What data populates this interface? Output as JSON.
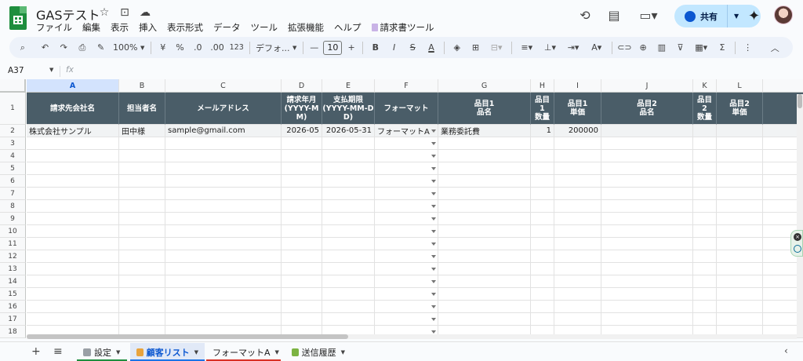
{
  "app": {
    "title": "GASテスト",
    "title_icons": [
      "star-icon",
      "move-to-folder-icon",
      "cloud-saved-icon"
    ]
  },
  "menu": [
    "ファイル",
    "編集",
    "表示",
    "挿入",
    "表示形式",
    "データ",
    "ツール",
    "拡張機能",
    "ヘルプ"
  ],
  "menu_ext": "請求書ツール",
  "share": {
    "label": "共有"
  },
  "toolbar": {
    "zoom": "100%",
    "currency": "¥",
    "percent": "%",
    "dec_decrease": ".0",
    "dec_increase": ".00",
    "number_format": "123",
    "font": "デフォ...",
    "font_size": "10",
    "minus": "—",
    "plus": "+",
    "bold": "B",
    "italic": "I",
    "strike": "S",
    "text_color": "A",
    "sum": "Σ",
    "more": "⋮",
    "collapse": "︿"
  },
  "formula_bar": {
    "name_box": "A37",
    "fx": "fx"
  },
  "columns": [
    "A",
    "B",
    "C",
    "D",
    "E",
    "F",
    "G",
    "H",
    "I",
    "J",
    "K",
    "L"
  ],
  "selected_column": "A",
  "header_row": {
    "row_number": "1",
    "cells": [
      "請求先会社名",
      "担当者名",
      "メールアドレス",
      "請求年月\n(YYYY-M\nM)",
      "支払期限\n(YYYY-MM-D\nD)",
      "フォーマット",
      "品目1\n品名",
      "品目\n1\n数量",
      "品目1\n単価",
      "品目2\n品名",
      "品目\n2\n数量",
      "品目2\n単価"
    ]
  },
  "data_rows": [
    {
      "row_number": "2",
      "cells": [
        "株式会社サンプル",
        "田中様",
        "sample@gmail.com",
        "2026-05",
        "2026-05-31",
        "フォーマットA",
        "業務委託費",
        "1",
        "200000",
        "",
        "",
        ""
      ]
    }
  ],
  "empty_row_numbers": [
    "3",
    "4",
    "5",
    "6",
    "7",
    "8",
    "9",
    "10",
    "11",
    "12",
    "13",
    "14",
    "15",
    "16",
    "17",
    "18"
  ],
  "sheet_tabs": [
    {
      "label": "設定",
      "icon": "gear-icon",
      "active": false,
      "underline": "#1e8e3e",
      "icon_color": "#9aa0a6"
    },
    {
      "label": "顧客リスト",
      "icon": "clipboard-icon",
      "active": true,
      "underline": "#1a73e8",
      "icon_color": "#e8a33d"
    },
    {
      "label": "フォーマットA",
      "icon": "",
      "active": false,
      "underline": "#d93025",
      "icon_color": ""
    },
    {
      "label": "送信履歴",
      "icon": "chart-icon",
      "active": false,
      "underline": "",
      "icon_color": "#7cb342"
    }
  ],
  "colors": {
    "header_bg": "#4a5d68",
    "share_bg": "#c2e7ff",
    "toolbar_bg": "#edf2fa",
    "selected_col": "#d3e3fd"
  }
}
